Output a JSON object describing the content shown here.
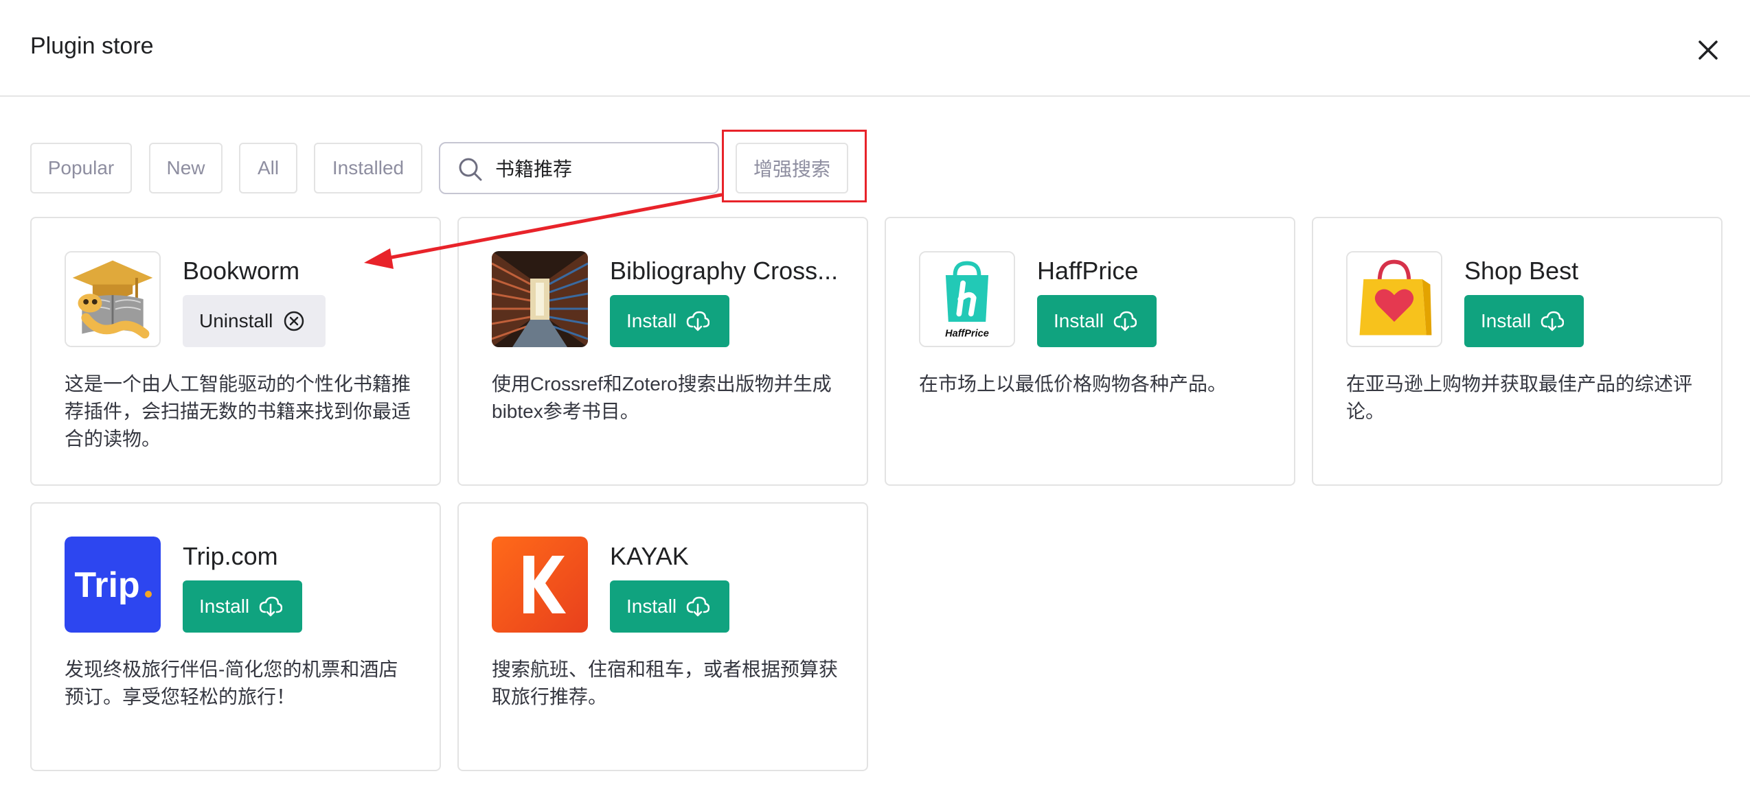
{
  "header": {
    "title": "Plugin store",
    "close_icon": "close-icon"
  },
  "filters": [
    "Popular",
    "New",
    "All",
    "Installed"
  ],
  "search": {
    "value": "书籍推荐",
    "placeholder": ""
  },
  "enhanced_search_label": "增强搜索",
  "annotation_colors": {
    "highlight": "#e8232a"
  },
  "colors": {
    "install_button": "#10a37f",
    "uninstall_button": "#ececf1"
  },
  "plugins": [
    {
      "name": "Bookworm",
      "action": "Uninstall",
      "action_icon": "x-circle-icon",
      "description": "这是一个由人工智能驱动的个性化书籍推荐插件，会扫描无数的书籍来找到你最适合的读物。",
      "logo": "bookworm-logo"
    },
    {
      "name": "Bibliography Cross...",
      "action": "Install",
      "action_icon": "cloud-download-icon",
      "description": "使用Crossref和Zotero搜索出版物并生成bibtex参考书目。",
      "logo": "library-shelves-logo"
    },
    {
      "name": "HaffPrice",
      "action": "Install",
      "action_icon": "cloud-download-icon",
      "description": "在市场上以最低价格购物各种产品。",
      "logo": "haffprice-logo",
      "logo_text": "HaffPrice"
    },
    {
      "name": "Shop Best",
      "action": "Install",
      "action_icon": "cloud-download-icon",
      "description": "在亚马逊上购物并获取最佳产品的综述评论。",
      "logo": "shopping-bag-heart-logo"
    },
    {
      "name": "Trip.com",
      "action": "Install",
      "action_icon": "cloud-download-icon",
      "description": "发现终极旅行伴侣-简化您的机票和酒店预订。享受您轻松的旅行！",
      "logo": "trip-logo"
    },
    {
      "name": "KAYAK",
      "action": "Install",
      "action_icon": "cloud-download-icon",
      "description": "搜索航班、住宿和租车，或者根据预算获取旅行推荐。",
      "logo": "kayak-logo"
    }
  ]
}
